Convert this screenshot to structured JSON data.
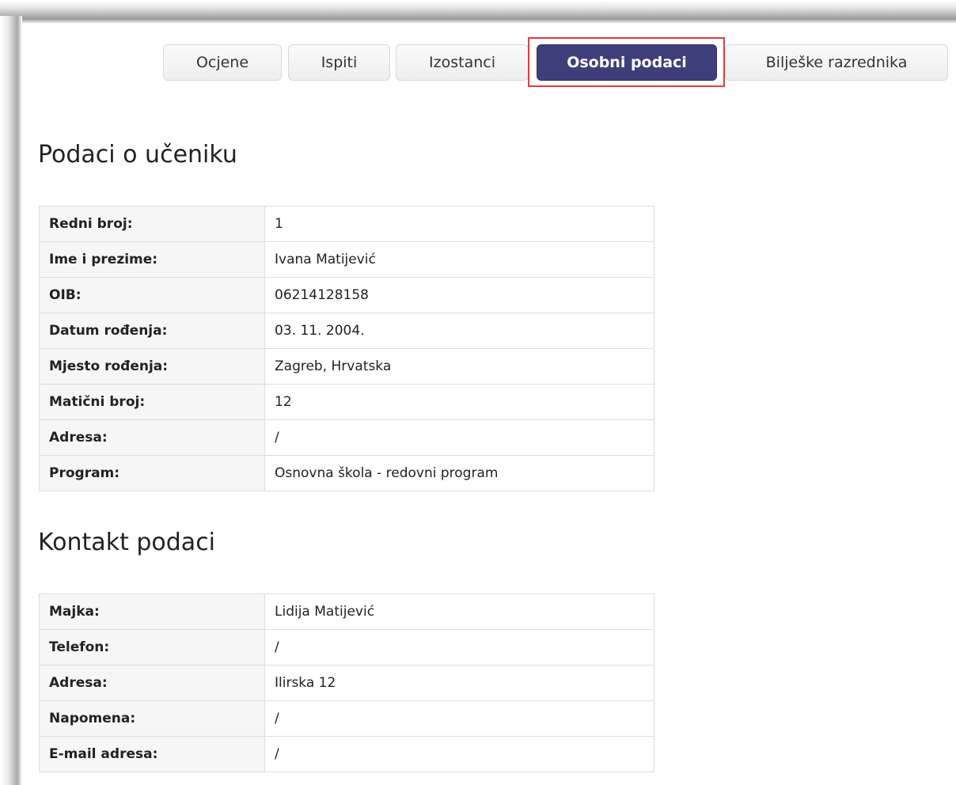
{
  "tabs": [
    {
      "label": "Ocjene",
      "active": false
    },
    {
      "label": "Ispiti",
      "active": false
    },
    {
      "label": "Izostanci",
      "active": false
    },
    {
      "label": "Osobni podaci",
      "active": true
    },
    {
      "label": "Bilješke razrednika",
      "active": false
    }
  ],
  "student_section": {
    "title": "Podaci o učeniku",
    "rows": [
      {
        "label": "Redni broj:",
        "value": "1"
      },
      {
        "label": "Ime i prezime:",
        "value": "Ivana Matijević"
      },
      {
        "label": "OIB:",
        "value": "06214128158"
      },
      {
        "label": "Datum rođenja:",
        "value": "03. 11. 2004."
      },
      {
        "label": "Mjesto rođenja:",
        "value": "Zagreb, Hrvatska"
      },
      {
        "label": "Matični broj:",
        "value": "12"
      },
      {
        "label": "Adresa:",
        "value": "/"
      },
      {
        "label": "Program:",
        "value": "Osnovna škola - redovni program"
      }
    ]
  },
  "contact_section": {
    "title": "Kontakt podaci",
    "rows": [
      {
        "label": "Majka:",
        "value": "Lidija Matijević"
      },
      {
        "label": "Telefon:",
        "value": "/"
      },
      {
        "label": "Adresa:",
        "value": "Ilirska 12"
      },
      {
        "label": "Napomena:",
        "value": "/"
      },
      {
        "label": "E-mail adresa:",
        "value": "/"
      }
    ]
  },
  "colors": {
    "active_tab": "#3e3f7a",
    "highlight_border": "#e23b3b"
  }
}
